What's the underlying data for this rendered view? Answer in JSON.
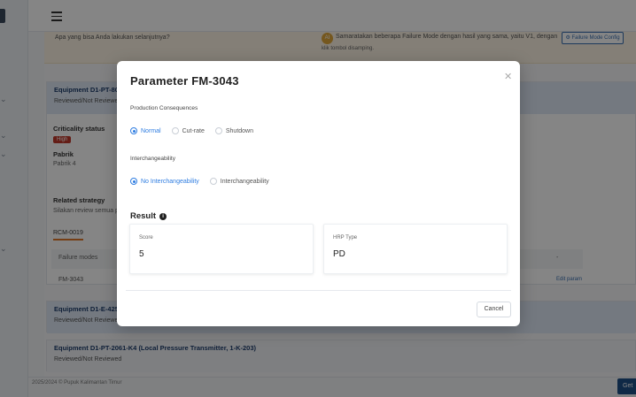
{
  "suggestion": {
    "question": "Apa yang bisa Anda lakukan selanjutnya?",
    "badge": "AI",
    "text": "Samaratakan beberapa Failure Mode dengan hasil yang sama, yaitu V1, dengan",
    "subtext": "klik tombol disamping.",
    "button_label": "Failure Mode Config"
  },
  "cards": [
    {
      "title": "Equipment D1-PT-80",
      "subtitle": "Reviewed/Not Reviewed"
    },
    {
      "title": "Equipment D1-E-425-",
      "subtitle": "Reviewed/Not Reviewed"
    },
    {
      "title": "Equipment D1-PT-2061-K4 (Local Pressure Transmitter, 1-K-203)",
      "subtitle": "Reviewed/Not Reviewed"
    }
  ],
  "details": {
    "criticality_label": "Criticality status",
    "criticality_value": "High",
    "factory_label": "Pabrik",
    "factory_value": "Pabrik 4",
    "related_label": "Related strategy",
    "related_value": "Silakan review semua p",
    "tab_label": "RCM-0019",
    "fm_header": "Failure modes",
    "fm_dash": "-",
    "fm_row_id": "FM-3043",
    "edit_link": "Edit param"
  },
  "footer": {
    "text": "2025/2024 © Pupuk Kalimantan Timur",
    "get_button": "Get"
  },
  "modal": {
    "title": "Parameter FM-3043",
    "production": {
      "label": "Production Consequences",
      "options": [
        "Normal",
        "Cut-rate",
        "Shutdown"
      ],
      "selected": "Normal"
    },
    "interchangeability": {
      "label": "Interchangeability",
      "options": [
        "No Interchangeability",
        "Interchangeability"
      ],
      "selected": "No Interchangeability"
    },
    "result": {
      "title": "Result",
      "score_label": "Score",
      "score_value": "5",
      "hrp_label": "HRP Type",
      "hrp_value": "PD"
    },
    "cancel_label": "Cancel"
  },
  "colors": {
    "primary": "#2f7de1",
    "badge_high": "#c0392b",
    "card_header": "#dfe9f5"
  }
}
